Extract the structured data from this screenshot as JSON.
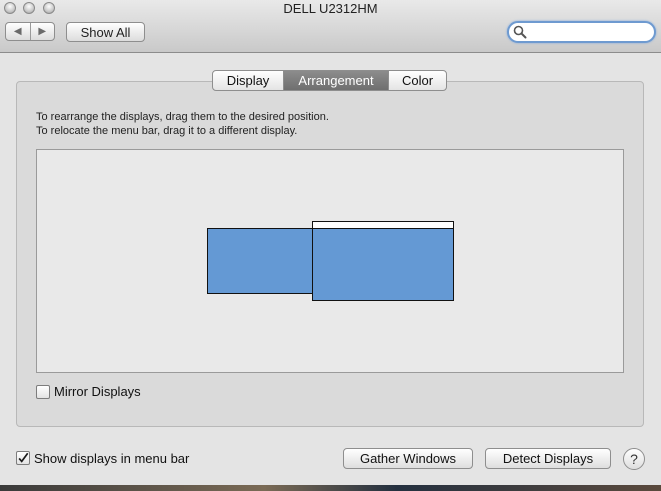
{
  "window": {
    "title": "DELL U2312HM"
  },
  "toolbar": {
    "back_glyph": "◀",
    "forward_glyph": "▶",
    "show_all_label": "Show All",
    "search_placeholder": "",
    "search_value": ""
  },
  "tabs": [
    {
      "label": "Display",
      "selected": false
    },
    {
      "label": "Arrangement",
      "selected": true
    },
    {
      "label": "Color",
      "selected": false
    }
  ],
  "instructions": {
    "line1": "To rearrange the displays, drag them to the desired position.",
    "line2": "To relocate the menu bar, drag it to a different display."
  },
  "colors": {
    "display_fill": "#6499d4",
    "selected_tab": "#7c7c7c",
    "search_focus": "#6e9ad0"
  },
  "mirror_displays": {
    "label": "Mirror Displays",
    "checked": false
  },
  "show_in_menu_bar": {
    "label": "Show displays in menu bar",
    "checked": true
  },
  "buttons": {
    "gather_windows": "Gather Windows",
    "detect_displays": "Detect Displays",
    "help": "?"
  },
  "icons": {
    "search": "magnifier-icon",
    "back": "back-arrow-icon",
    "forward": "forward-arrow-icon",
    "checkmark": "checkmark-icon"
  }
}
